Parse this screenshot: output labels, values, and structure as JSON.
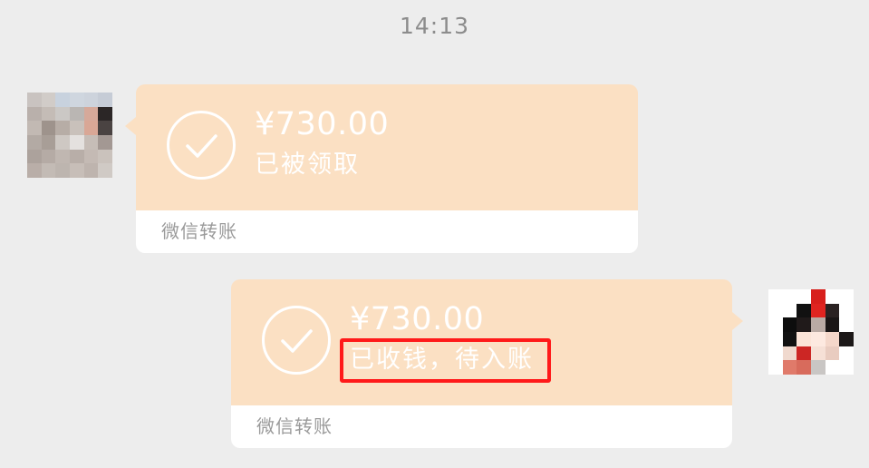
{
  "chat": {
    "timestamp": "14:13",
    "messages": [
      {
        "side": "left",
        "amount": "¥730.00",
        "status": "已被领取",
        "footer": "微信转账"
      },
      {
        "side": "right",
        "amount": "¥730.00",
        "status": "已收钱，待入账",
        "footer": "微信转账"
      }
    ]
  },
  "colors": {
    "background": "#ededed",
    "bubble_top": "#fbe0c3",
    "bubble_bottom": "#ffffff",
    "highlight": "#ff1a1a"
  },
  "icons": {
    "transfer_status": "check-circle-icon"
  }
}
